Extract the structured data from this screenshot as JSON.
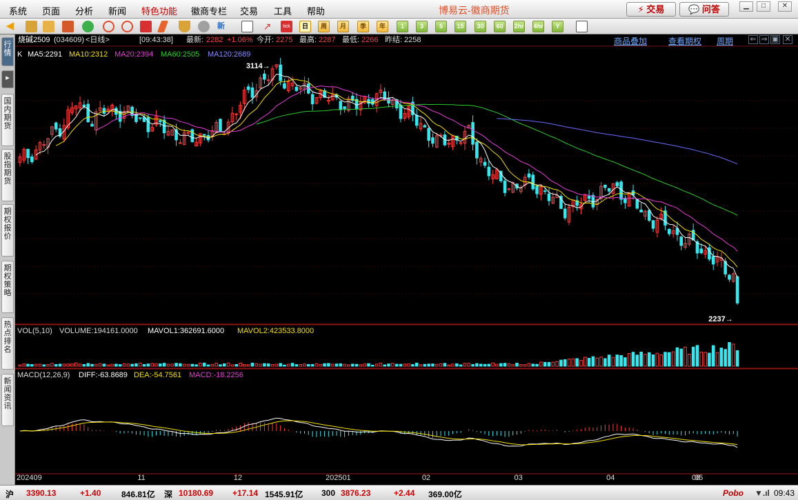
{
  "menu": {
    "items": [
      "系统",
      "页面",
      "分析",
      "新闻",
      "特色功能",
      "徽商专栏",
      "交易",
      "工具",
      "帮助"
    ],
    "brand": "博易云-徽商期货",
    "trade_button": "⚡ 交易",
    "ask_button": "💬 问答"
  },
  "toolbar": {
    "periods": [
      "日",
      "周",
      "月",
      "季",
      "年",
      "1",
      "3",
      "5",
      "15",
      "30",
      "60",
      "2hr",
      "4hr",
      "Y"
    ],
    "active_period": "日"
  },
  "sidebar": {
    "tabs": [
      "行情",
      "国内期货",
      "股指期货",
      "期权报价",
      "期权策略",
      "热点排名",
      "新闻资讯"
    ]
  },
  "info": {
    "symbol": "烧碱2509",
    "code": "(034609)",
    "period": "<日线>",
    "time": "[09:43:38]",
    "last_label": "最新:",
    "last": "2282",
    "change": "+1.06%",
    "open_label": "今开:",
    "open": "2275",
    "high_label": "最高:",
    "high": "2287",
    "low_label": "最低:",
    "low": "2266",
    "prev_label": "昨结:",
    "prev": "2258",
    "links": [
      "商品叠加",
      "查看期权",
      "周期"
    ]
  },
  "indicators": {
    "k_label": "K",
    "ma5": "MA5:2291",
    "ma10": "MA10:2312",
    "ma20": "MA20:2394",
    "ma60": "MA60:2505",
    "ma120": "MA120:2689",
    "vol": "VOL(5,10)",
    "volume": "VOLUME:194161.0000",
    "mavol1": "MAVOL1:362691.6000",
    "mavol2": "MAVOL2:423533.8000",
    "macd": "MACD(12,26,9)",
    "diff": "DIFF:-63.8689",
    "dea": "DEA:-54.7561",
    "macd_val": "MACD:-18.2256"
  },
  "colors": {
    "up": "#ff3c3c",
    "down": "#35e8f0",
    "ma5": "#ffffff",
    "ma10": "#f5e000",
    "ma20": "#e83cd8",
    "ma60": "#2ccc2c",
    "ma120": "#6a6aff"
  },
  "chart_data": {
    "type": "candlestick",
    "symbol": "烧碱2509",
    "period": "日线",
    "x_ticks": [
      "202409",
      "11",
      "12",
      "202501",
      "02",
      "03",
      "04",
      "05",
      "06"
    ],
    "high_mark": 3114,
    "low_mark": 2237,
    "price_range": [
      2237,
      3114
    ],
    "price_path": [
      [
        0,
        2780
      ],
      [
        5,
        2830
      ],
      [
        10,
        2900
      ],
      [
        14,
        2980
      ],
      [
        18,
        2930
      ],
      [
        22,
        2960
      ],
      [
        26,
        2950
      ],
      [
        30,
        2920
      ],
      [
        34,
        2905
      ],
      [
        38,
        2880
      ],
      [
        42,
        2850
      ],
      [
        46,
        2875
      ],
      [
        50,
        2880
      ],
      [
        55,
        2980
      ],
      [
        60,
        3060
      ],
      [
        64,
        3090
      ],
      [
        68,
        3040
      ],
      [
        72,
        3020
      ],
      [
        76,
        3000
      ],
      [
        80,
        2990
      ],
      [
        84,
        2970
      ],
      [
        88,
        3010
      ],
      [
        92,
        2990
      ],
      [
        96,
        2950
      ],
      [
        100,
        2910
      ],
      [
        104,
        2840
      ],
      [
        108,
        2860
      ],
      [
        112,
        2870
      ],
      [
        116,
        2760
      ],
      [
        120,
        2700
      ],
      [
        124,
        2690
      ],
      [
        128,
        2705
      ],
      [
        132,
        2650
      ],
      [
        136,
        2615
      ],
      [
        140,
        2630
      ],
      [
        144,
        2660
      ],
      [
        148,
        2690
      ],
      [
        152,
        2650
      ],
      [
        156,
        2590
      ],
      [
        160,
        2560
      ],
      [
        166,
        2500
      ],
      [
        172,
        2450
      ],
      [
        176,
        2395
      ],
      [
        178,
        2380
      ]
    ],
    "ma5_last": 2291,
    "ma10_last": 2312,
    "ma20_last": 2394,
    "ma60_last": 2505,
    "ma120_last": 2689,
    "volume_last": 194161,
    "mavol1_last": 362691.6,
    "mavol2_last": 423533.8,
    "diff_last": -63.8689,
    "dea_last": -54.7561,
    "macd_last": -18.2256
  },
  "status": {
    "sh_label": "沪",
    "sh_value": "3390.13",
    "sh_change": "+1.40",
    "sh_amount": "846.81亿",
    "sz_label": "深",
    "sz_value": "10180.69",
    "sz_change": "+17.14",
    "sz_amount": "1545.91亿",
    "idx300_label": "300",
    "idx300_value": "3876.23",
    "idx300_change": "+2.44",
    "idx300_amount": "369.00亿",
    "pobo": "Pobo",
    "clock": "09:43"
  }
}
